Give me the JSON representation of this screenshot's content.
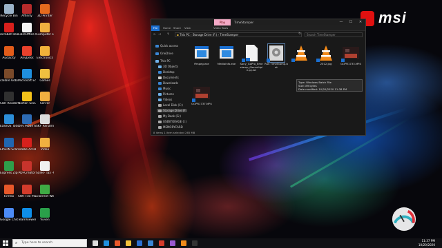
{
  "desktop": {
    "icons": [
      {
        "label": "Recycle Bin",
        "color": "#9bb3c9"
      },
      {
        "label": "Affinity",
        "color": "#b52b2b"
      },
      {
        "label": "3D Printer",
        "color": "#e56a1e"
      },
      {
        "label": "Acrobat Reader DC",
        "color": "#d8201c"
      },
      {
        "label": "LibreOffice 6.1",
        "color": "#f4f4f4"
      },
      {
        "label": "Computer software",
        "color": "#f0b040"
      },
      {
        "label": "Audacity",
        "color": "#e25c1a"
      },
      {
        "label": "AnyDesk",
        "color": "#e8412c"
      },
      {
        "label": "Electronics",
        "color": "#f3b23a"
      },
      {
        "label": "calibre 64bit - E-book ma...",
        "color": "#7a4a2a"
      },
      {
        "label": "Microsoft Edge",
        "color": "#1f8fde"
      },
      {
        "label": "Games",
        "color": "#f0c040"
      },
      {
        "label": "CBR Reader",
        "color": "#303030"
      },
      {
        "label": "Norton Securi...",
        "color": "#f4c21a"
      },
      {
        "label": "Server",
        "color": "#f0b040"
      },
      {
        "label": "EaseUS Todo Backup Free",
        "color": "#2c8ed8"
      },
      {
        "label": "Dev Mode 64bit",
        "color": "#2d6cb5"
      },
      {
        "label": "SKF Renamin...",
        "color": "#dcdcdc"
      },
      {
        "label": "EPSON Scan",
        "color": "#2166b0"
      },
      {
        "label": "Adobe Acrobat",
        "color": "#d8201c"
      },
      {
        "label": "Video",
        "color": "#f0b040"
      },
      {
        "label": "Express Zip File Compr...",
        "color": "#2f9e4a"
      },
      {
        "label": "PDFCreator",
        "color": "#c8342c"
      },
      {
        "label": "Sales- Tax -C...",
        "color": "#f0f0f0"
      },
      {
        "label": "Firefox",
        "color": "#e8582a"
      },
      {
        "label": "SWF File Player",
        "color": "#d43b2b"
      },
      {
        "label": "uTorrent Web",
        "color": "#3faa44"
      },
      {
        "label": "Google Chrome",
        "color": "#4c8bf5"
      },
      {
        "label": "TeamViewer",
        "color": "#0e8ee9"
      },
      {
        "label": "Vivien",
        "color": "#2aa04a"
      }
    ]
  },
  "brand": {
    "logo_text": "msi"
  },
  "window": {
    "title": "TimeStamper",
    "tools_tab": "Play",
    "controls": {
      "minimize": "—",
      "maximize": "☐",
      "close": "✕"
    },
    "ribbon_tabs": [
      "File",
      "Home",
      "Share",
      "View",
      "Video Tools"
    ],
    "address": [
      "This PC",
      "Storage Drive (F:)",
      "TimeStamper"
    ],
    "search_placeholder": "Search TimeStamper",
    "nav": {
      "back": "←",
      "forward": "→",
      "up": "↑",
      "refresh": "↻",
      "items": [
        {
          "label": "Quick access",
          "icon_color": "#3a86d4"
        },
        {
          "label": "OneDrive",
          "icon_color": "#3a86d4"
        },
        {
          "label": "This PC",
          "icon_color": "#6fb2ea"
        },
        {
          "label": "3D Objects",
          "icon_color": "#6fb2ea"
        },
        {
          "label": "Desktop",
          "icon_color": "#3a86d4"
        },
        {
          "label": "Documents",
          "icon_color": "#cfcfcf"
        },
        {
          "label": "Downloads",
          "icon_color": "#3a86d4"
        },
        {
          "label": "Music",
          "icon_color": "#3a86d4"
        },
        {
          "label": "Pictures",
          "icon_color": "#6fb2ea"
        },
        {
          "label": "Videos",
          "icon_color": "#6fb2ea"
        },
        {
          "label": "Local Disk (C:)",
          "icon_color": "#aaaaaa"
        },
        {
          "label": "Storage Drive (F:)",
          "icon_color": "#aaaaaa"
        },
        {
          "label": "My Book (G:)",
          "icon_color": "#aaaaaa"
        },
        {
          "label": "USBSTORAGE (I:)",
          "icon_color": "#aaaaaa"
        },
        {
          "label": "MEMORYCARD",
          "icon_color": "#aaaaaa"
        }
      ]
    },
    "files": [
      {
        "name": "ffmpeg.exe",
        "type": "exe"
      },
      {
        "name": "Mediainfo.exe",
        "type": "exe"
      },
      {
        "name": "Sony_GoPro_timestamp_filemultiple.py.txt",
        "type": "doc"
      },
      {
        "name": "Run TimeStamp.bat",
        "type": "bat"
      },
      {
        "name": "",
        "type": "vlc"
      },
      {
        "name": "2012.jpg",
        "type": "vlc"
      },
      {
        "name": "GOPR1733.MP4",
        "type": "video"
      },
      {
        "name": "GOPR1737.MP4",
        "type": "video"
      }
    ],
    "tooltip": {
      "type_line": "Type: Windows Batch File",
      "size_line": "Size: 89 bytes",
      "date_line": "Date modified: 10/20/2020 11:38 PM"
    },
    "status": "8 items   1 item selected 265 MB"
  },
  "taskbar": {
    "search_placeholder": "Type here to search",
    "search_icon": "search-icon",
    "apps": [
      {
        "name": "task-view-icon",
        "color": "#dddddd"
      },
      {
        "name": "edge-icon",
        "color": "#1f8fde"
      },
      {
        "name": "firefox-icon",
        "color": "#e8582a"
      },
      {
        "name": "explorer-icon",
        "color": "#f2c23a"
      },
      {
        "name": "store-icon",
        "color": "#2c6fd1"
      },
      {
        "name": "mail-icon",
        "color": "#3a86d4"
      },
      {
        "name": "media-icon",
        "color": "#d43b2b"
      },
      {
        "name": "app-icon",
        "color": "#9a59d0"
      },
      {
        "name": "vlc-icon",
        "color": "#f18a1a"
      },
      {
        "name": "terminal-icon",
        "color": "#333333"
      }
    ],
    "clock": {
      "time": "11:37 PM",
      "date": "10/20/2020"
    }
  }
}
